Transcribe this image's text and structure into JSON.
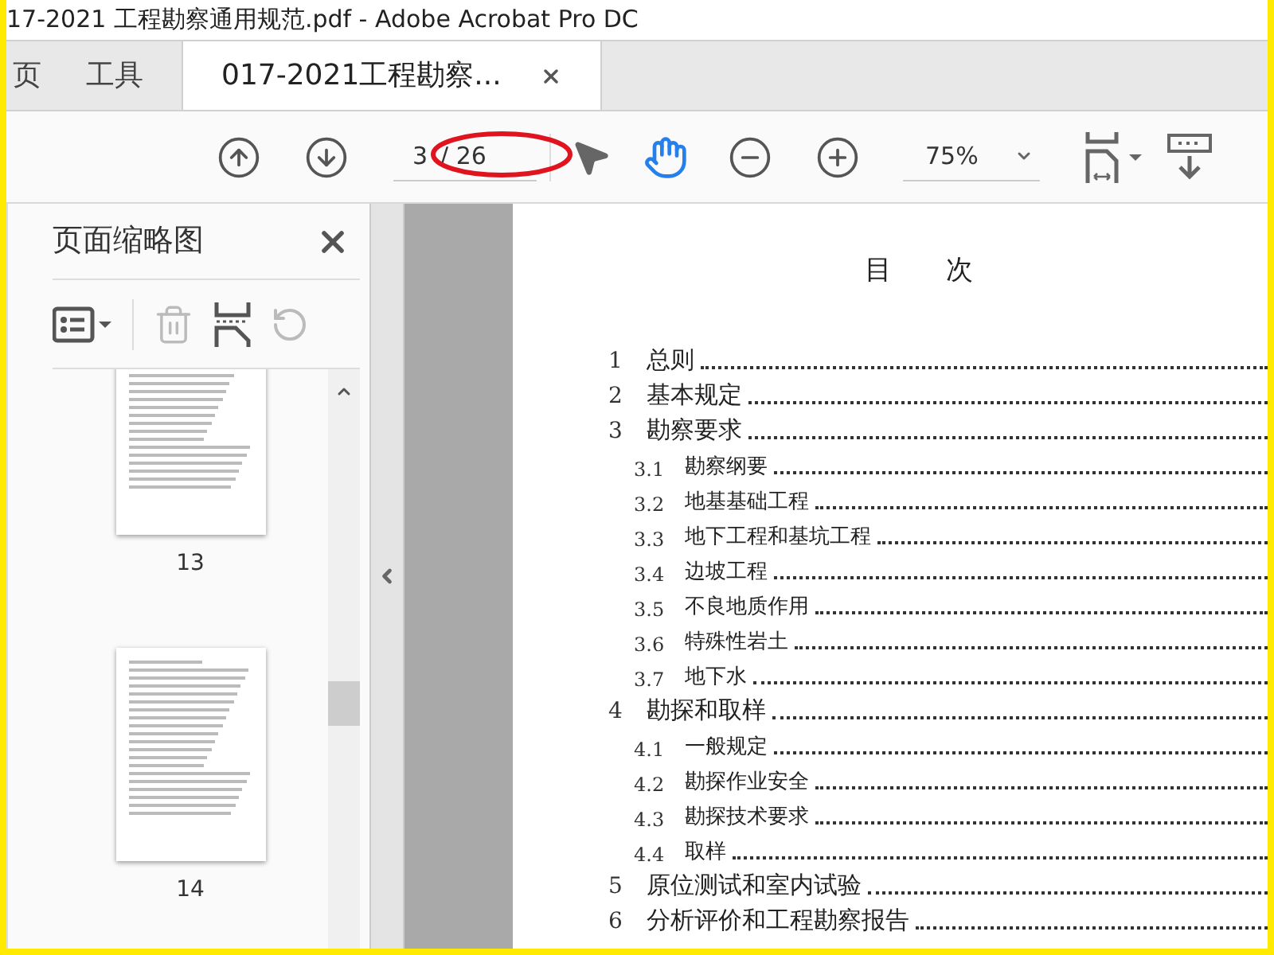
{
  "window": {
    "title": "17-2021 工程勘察通用规范.pdf - Adobe Acrobat Pro DC"
  },
  "tabs": [
    {
      "label": "页",
      "selected": false,
      "closable": false
    },
    {
      "label": "工具",
      "selected": false,
      "closable": false
    },
    {
      "label": "017-2021工程勘察...",
      "selected": true,
      "closable": true
    }
  ],
  "toolbar": {
    "page_current": "3",
    "page_total": "/ 26",
    "zoom": "75%",
    "tools": [
      {
        "kind": "select",
        "selected": false
      },
      {
        "kind": "hand",
        "selected": true
      }
    ],
    "page_highlighted": true
  },
  "sidebar": {
    "title": "页面缩略图",
    "thumbnails": [
      {
        "label": "13",
        "selected": false
      },
      {
        "label": "14",
        "selected": false
      }
    ]
  },
  "document": {
    "heading": "目　　次",
    "toc": [
      {
        "kind": "chapter",
        "number": "1",
        "title": "总则"
      },
      {
        "kind": "chapter",
        "number": "2",
        "title": "基本规定"
      },
      {
        "kind": "chapter",
        "number": "3",
        "title": "勘察要求"
      },
      {
        "kind": "section",
        "number": "3.1",
        "title": "勘察纲要"
      },
      {
        "kind": "section",
        "number": "3.2",
        "title": "地基基础工程"
      },
      {
        "kind": "section",
        "number": "3.3",
        "title": "地下工程和基坑工程"
      },
      {
        "kind": "section",
        "number": "3.4",
        "title": "边坡工程"
      },
      {
        "kind": "section",
        "number": "3.5",
        "title": "不良地质作用"
      },
      {
        "kind": "section",
        "number": "3.6",
        "title": "特殊性岩土"
      },
      {
        "kind": "section",
        "number": "3.7",
        "title": "地下水"
      },
      {
        "kind": "chapter",
        "number": "4",
        "title": "勘探和取样"
      },
      {
        "kind": "section",
        "number": "4.1",
        "title": "一般规定"
      },
      {
        "kind": "section",
        "number": "4.2",
        "title": "勘探作业安全"
      },
      {
        "kind": "section",
        "number": "4.3",
        "title": "勘探技术要求"
      },
      {
        "kind": "section",
        "number": "4.4",
        "title": "取样"
      },
      {
        "kind": "chapter",
        "number": "5",
        "title": "原位测试和室内试验"
      },
      {
        "kind": "chapter",
        "number": "6",
        "title": "分析评价和工程勘察报告"
      }
    ]
  }
}
